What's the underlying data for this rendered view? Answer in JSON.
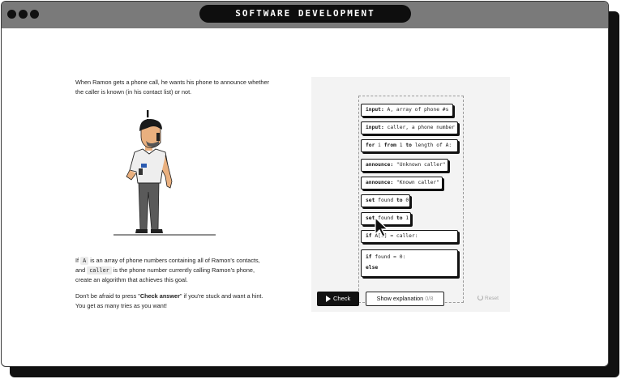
{
  "window": {
    "title": "SOFTWARE DEVELOPMENT"
  },
  "intro": {
    "line1": "When Ramon gets a phone call, he wants his phone to announce whether",
    "line2": "the caller is known (in his contact list) or not."
  },
  "problem": {
    "p1_a": "If",
    "var_a": "A",
    "p1_b": "is an array of phone numbers containing all of Ramon's contacts,",
    "p2_a": "and",
    "var_caller": "caller",
    "p2_b": "is the phone number currently calling Ramon's phone,",
    "p3": "create an algorithm that achieves this goal."
  },
  "hint": {
    "h1_a": "Don't be afraid to press \"",
    "h1_strong": "Check answer",
    "h1_b": "\" if you're stuck and want a hint.",
    "h2": "You get as many tries as you want!"
  },
  "blocks": [
    {
      "kw": "input:",
      "text": "A, array of phone #s"
    },
    {
      "kw": "input:",
      "text": "caller, a phone number"
    },
    {
      "kw": "for",
      "text": "i",
      "kw2": "from",
      "text2": "1",
      "kw3": "to",
      "text3": "length of A:"
    },
    {
      "kw": "announce:",
      "text": "\"Unknown caller\""
    },
    {
      "kw": "announce:",
      "text": "\"Known caller\""
    },
    {
      "kw": "set",
      "text": "found",
      "kw2": "to",
      "text2": "0"
    },
    {
      "kw": "set",
      "text": "found",
      "kw2": "to",
      "text2": "1"
    },
    {
      "kw": "if",
      "text": "A[i] = caller:"
    },
    {
      "kw": "if",
      "text": "found = 0:",
      "line2_kw": "else"
    }
  ],
  "buttons": {
    "check": "Check",
    "explain": "Show explanation",
    "explain_count": "0/8",
    "reset": "Reset"
  },
  "icons": {
    "check": "play-icon",
    "reset": "reset-icon",
    "cursor": "pointer-cursor-icon"
  }
}
